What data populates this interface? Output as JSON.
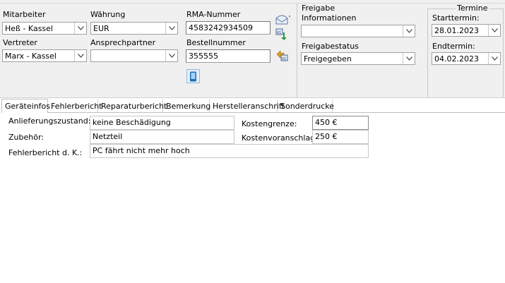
{
  "form": {
    "mitarbeiter": {
      "label": "Mitarbeiter",
      "value": "Heß - Kassel"
    },
    "vertreter": {
      "label": "Vertreter",
      "value": "Marx - Kassel"
    },
    "waehrung": {
      "label": "Währung",
      "value": "EUR"
    },
    "ansprechpartner": {
      "label": "Ansprechpartner",
      "value": ""
    },
    "rma": {
      "label": "RMA-Nummer",
      "value": "4583242934509"
    },
    "bestellnummer": {
      "label": "Bestellnummer",
      "value": "355555"
    }
  },
  "freigabe": {
    "title": "Freigabe",
    "informationen": {
      "label": "Informationen",
      "value": ""
    },
    "status": {
      "label": "Freigabestatus",
      "value": "Freigegeben"
    }
  },
  "termine": {
    "title": "Termine",
    "start": {
      "label": "Starttermin:",
      "value": "28.01.2023"
    },
    "end": {
      "label": "Endtermin:",
      "value": "04.02.2023"
    }
  },
  "tabs": [
    {
      "label": "Geräteinfos"
    },
    {
      "label": "Fehlerbericht"
    },
    {
      "label": "Reparaturbericht"
    },
    {
      "label": "Bemerkung"
    },
    {
      "label": "Herstelleranschrift"
    },
    {
      "label": "Sonderdrucke"
    }
  ],
  "details": {
    "anlieferungszustand": {
      "label": "Anlieferungszustand:",
      "value": "keine Beschädigung"
    },
    "zubehoer": {
      "label": "Zubehör:",
      "value": "Netzteil"
    },
    "fehlerbericht": {
      "label": "Fehlerbericht d. K.:",
      "value": "PC fährt nicht mehr hoch"
    },
    "kostengrenze": {
      "label": "Kostengrenze:",
      "value": "450 €"
    },
    "kostenvoranschlag": {
      "label": "Kostenvoranschlag",
      "value": "250 €"
    }
  }
}
